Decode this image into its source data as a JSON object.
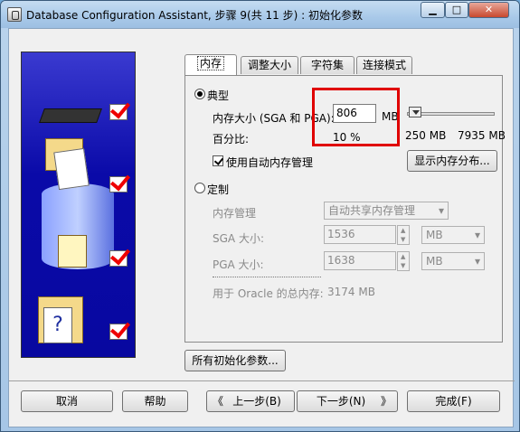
{
  "window": {
    "title": "Database Configuration Assistant, 步骤 9(共 11 步) : 初始化参数"
  },
  "tabs": [
    {
      "label": "内存"
    },
    {
      "label": "调整大小"
    },
    {
      "label": "字符集"
    },
    {
      "label": "连接模式"
    }
  ],
  "typical": {
    "radio_label": "典型",
    "memory_size_label": "内存大小 (SGA 和 PGA):",
    "memory_size_value": "806",
    "memory_unit": "MB",
    "percent_label": "百分比:",
    "percent_value": "10 %",
    "slider_min": "250 MB",
    "slider_max": "7935 MB",
    "auto_mem_label": "使用自动内存管理",
    "show_mem_button": "显示内存分布..."
  },
  "custom": {
    "radio_label": "定制",
    "mem_mgmt_label": "内存管理",
    "mem_mgmt_value": "自动共享内存管理",
    "sga_label": "SGA 大小:",
    "sga_value": "1536",
    "sga_unit": "MB",
    "pga_label": "PGA 大小:",
    "pga_value": "1638",
    "pga_unit": "MB",
    "total_label": "用于 Oracle 的总内存:",
    "total_value": "3174 MB"
  },
  "all_params_button": "所有初始化参数...",
  "footer": {
    "cancel": "取消",
    "help": "帮助",
    "back": "上一步(B)",
    "next": "下一步(N)",
    "finish": "完成(F)"
  }
}
